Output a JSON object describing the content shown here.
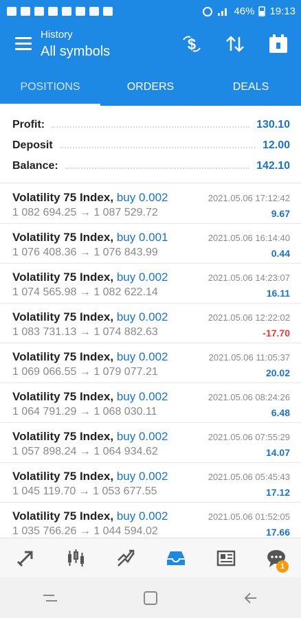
{
  "status_bar": {
    "battery": "46%",
    "time": "19:13"
  },
  "header": {
    "subtitle": "History",
    "title": "All symbols"
  },
  "tabs": [
    {
      "label": "POSITIONS"
    },
    {
      "label": "ORDERS"
    },
    {
      "label": "DEALS"
    }
  ],
  "summary": {
    "profit_label": "Profit:",
    "profit_value": "130.10",
    "deposit_label": "Deposit",
    "deposit_value": "12.00",
    "balance_label": "Balance:",
    "balance_value": "142.10"
  },
  "positions": [
    {
      "symbol": "Volatility 75 Index,",
      "side": "buy 0.002",
      "prices": "1 082 694.25 → 1 087 529.72",
      "time": "2021.05.06 17:12:42",
      "profit": "9.67"
    },
    {
      "symbol": "Volatility 75 Index,",
      "side": "buy 0.001",
      "prices": "1 076 408.36 → 1 076 843.99",
      "time": "2021.05.06 16:14:40",
      "profit": "0.44"
    },
    {
      "symbol": "Volatility 75 Index,",
      "side": "buy 0.002",
      "prices": "1 074 565.98 → 1 082 622.14",
      "time": "2021.05.06 14:23:07",
      "profit": "16.11"
    },
    {
      "symbol": "Volatility 75 Index,",
      "side": "buy 0.002",
      "prices": "1 083 731.13 → 1 074 882.63",
      "time": "2021.05.06 12:22:02",
      "profit": "-17.70"
    },
    {
      "symbol": "Volatility 75 Index,",
      "side": "buy 0.002",
      "prices": "1 069 066.55 → 1 079 077.21",
      "time": "2021.05.06 11:05:37",
      "profit": "20.02"
    },
    {
      "symbol": "Volatility 75 Index,",
      "side": "buy 0.002",
      "prices": "1 064 791.29 → 1 068 030.11",
      "time": "2021.05.06 08:24:26",
      "profit": "6.48"
    },
    {
      "symbol": "Volatility 75 Index,",
      "side": "buy 0.002",
      "prices": "1 057 898.24 → 1 064 934.62",
      "time": "2021.05.06 07:55:29",
      "profit": "14.07"
    },
    {
      "symbol": "Volatility 75 Index,",
      "side": "buy 0.002",
      "prices": "1 045 119.70 → 1 053 677.55",
      "time": "2021.05.06 05:45:43",
      "profit": "17.12"
    },
    {
      "symbol": "Volatility 75 Index,",
      "side": "buy 0.002",
      "prices": "1 035 766.26 → 1 044 594.02",
      "time": "2021.05.06 01:52:05",
      "profit": "17.66"
    }
  ],
  "bottom_nav": {
    "items": [
      "quotes-icon",
      "chart-icon",
      "trade-icon",
      "history-icon",
      "news-icon",
      "chat-icon"
    ],
    "chat_badge": "1"
  },
  "colors": {
    "primary": "#1e88e5",
    "profit_positive": "#1a73c8",
    "profit_negative": "#e53935"
  }
}
